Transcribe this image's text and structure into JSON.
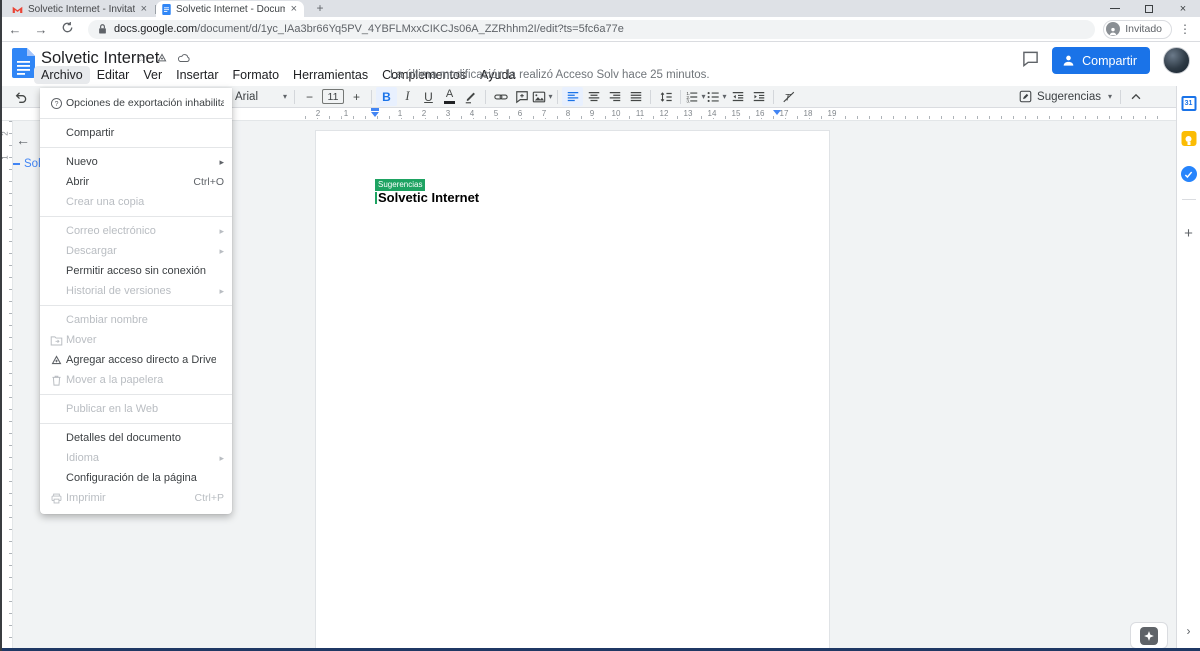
{
  "browser": {
    "tabs": [
      {
        "icon": "gmail",
        "title": "Solvetic Internet - Invitation to c",
        "active": false
      },
      {
        "icon": "docs",
        "title": "Solvetic Internet - Documentos d",
        "active": true
      }
    ],
    "url_domain": "docs.google.com",
    "url_path": "/document/d/1yc_IAa3br66Yq5PV_4YBFLMxxCIKCJs06A_ZZRhhm2I/edit?ts=5fc6a77e",
    "profile_label": "Invitado"
  },
  "header": {
    "doc_title": "Solvetic Internet",
    "menu_items": [
      "Archivo",
      "Editar",
      "Ver",
      "Insertar",
      "Formato",
      "Herramientas",
      "Complementos",
      "Ayuda"
    ],
    "active_menu_index": 0,
    "last_edit_status": "La última modificación la realizó Acceso Solv hace 25 minutos.",
    "share_button": "Compartir"
  },
  "toolbar": {
    "font_name": "Arial",
    "font_size": "11",
    "mode_button": "Sugerencias"
  },
  "file_menu": {
    "notice": {
      "icon": "help-circle",
      "label": "Opciones de exportación inhabilitadas"
    },
    "sections": [
      {
        "items": [
          {
            "label": "Compartir"
          }
        ]
      },
      {
        "items": [
          {
            "label": "Nuevo",
            "submenu": true
          },
          {
            "label": "Abrir",
            "shortcut": "Ctrl+O"
          },
          {
            "label": "Crear una copia",
            "disabled": true
          }
        ]
      },
      {
        "items": [
          {
            "label": "Correo electrónico",
            "disabled": true,
            "submenu": true
          },
          {
            "label": "Descargar",
            "disabled": true,
            "submenu": true
          },
          {
            "label": "Permitir acceso sin conexión"
          },
          {
            "label": "Historial de versiones",
            "disabled": true,
            "submenu": true
          }
        ]
      },
      {
        "items": [
          {
            "label": "Cambiar nombre",
            "disabled": true
          },
          {
            "label": "Mover",
            "disabled": true,
            "icon": "folder-move"
          },
          {
            "label": "Agregar acceso directo a Drive",
            "icon": "drive-shortcut"
          },
          {
            "label": "Mover a la papelera",
            "disabled": true,
            "icon": "trash"
          }
        ]
      },
      {
        "items": [
          {
            "label": "Publicar en la Web",
            "disabled": true
          }
        ]
      },
      {
        "items": [
          {
            "label": "Detalles del documento"
          },
          {
            "label": "Idioma",
            "disabled": true,
            "submenu": true
          },
          {
            "label": "Configuración de la página"
          },
          {
            "label": "Imprimir",
            "disabled": true,
            "icon": "printer",
            "shortcut": "Ctrl+P"
          }
        ]
      }
    ]
  },
  "document": {
    "suggestion_chip": "Sugerencias",
    "heading": "Solvetic Internet",
    "outline_item": "Solvetic Internet"
  },
  "ruler": {
    "left_numbers": [
      "2",
      "1"
    ],
    "numbers": [
      "1",
      "2",
      "3",
      "4",
      "5",
      "6",
      "7",
      "8",
      "9",
      "10",
      "11",
      "12",
      "13",
      "14",
      "15",
      "16",
      "17",
      "18",
      "19"
    ],
    "vertical_numbers": [
      "2",
      "1"
    ]
  },
  "rightbar": {
    "calendar_day": "31"
  },
  "colors": {
    "accent_blue": "#1A73E8",
    "suggestion_green": "#1EA362",
    "docs_icon_blue": "#3086F6",
    "outline_link_blue": "#4285F4",
    "keep_yellow": "#FBBC04",
    "gmail_red": "#EA4335",
    "toolbar_gray": "#F1F3F4"
  }
}
